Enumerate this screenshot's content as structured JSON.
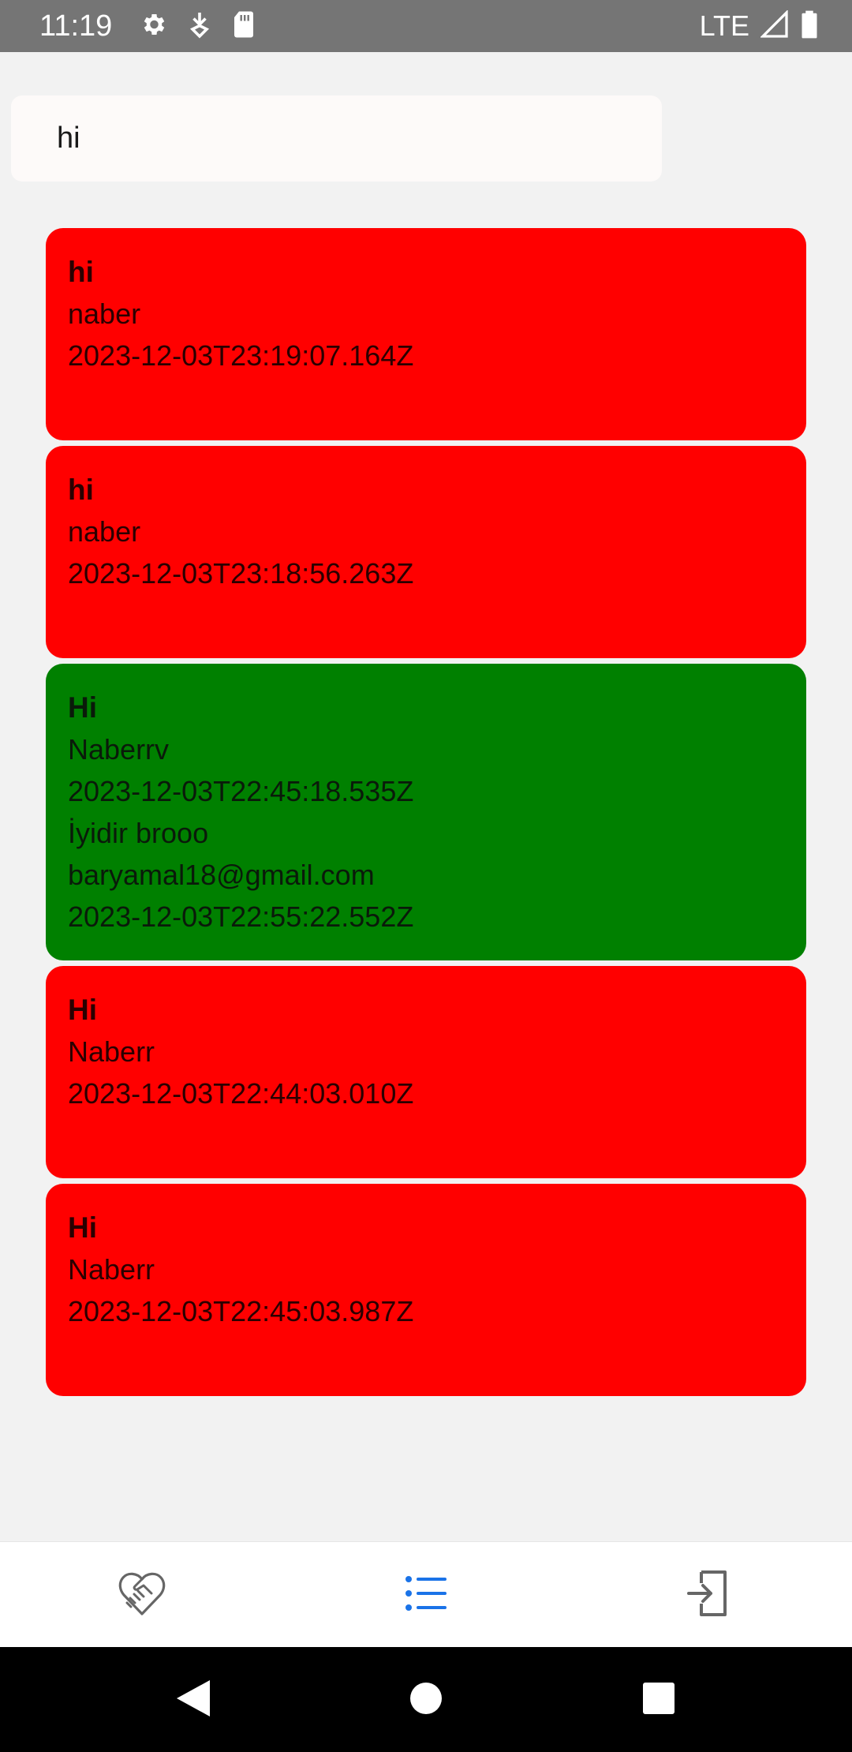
{
  "status_bar": {
    "time": "11:19",
    "network": "LTE",
    "icons": [
      "settings-icon",
      "download-icon",
      "sd-card-icon",
      "signal-icon",
      "battery-icon"
    ]
  },
  "search": {
    "value": "hi",
    "placeholder": ""
  },
  "cards": [
    {
      "title": "hi",
      "lines": [
        "naber",
        "2023-12-03T23:19:07.164Z"
      ],
      "color": "#ff0000"
    },
    {
      "title": "hi",
      "lines": [
        "naber",
        "2023-12-03T23:18:56.263Z"
      ],
      "color": "#ff0000"
    },
    {
      "title": "Hi",
      "lines": [
        "Naberrv",
        "2023-12-03T22:45:18.535Z",
        "İyidir brooo",
        "baryamal18@gmail.com",
        "2023-12-03T22:55:22.552Z"
      ],
      "color": "#008000"
    },
    {
      "title": "Hi",
      "lines": [
        "Naberr",
        "2023-12-03T22:44:03.010Z"
      ],
      "color": "#ff0000"
    },
    {
      "title": "Hi",
      "lines": [
        "Naberr",
        "2023-12-03T22:45:03.987Z"
      ],
      "color": "#ff0000"
    }
  ],
  "tab_bar": {
    "tabs": [
      {
        "icon": "handshake-icon",
        "active": false
      },
      {
        "icon": "list-icon",
        "active": true
      },
      {
        "icon": "login-icon",
        "active": false
      }
    ],
    "active_color": "#1a73e8",
    "inactive_color": "#666666"
  },
  "nav_bar": {
    "buttons": [
      "back-icon",
      "home-icon",
      "recents-icon"
    ]
  }
}
